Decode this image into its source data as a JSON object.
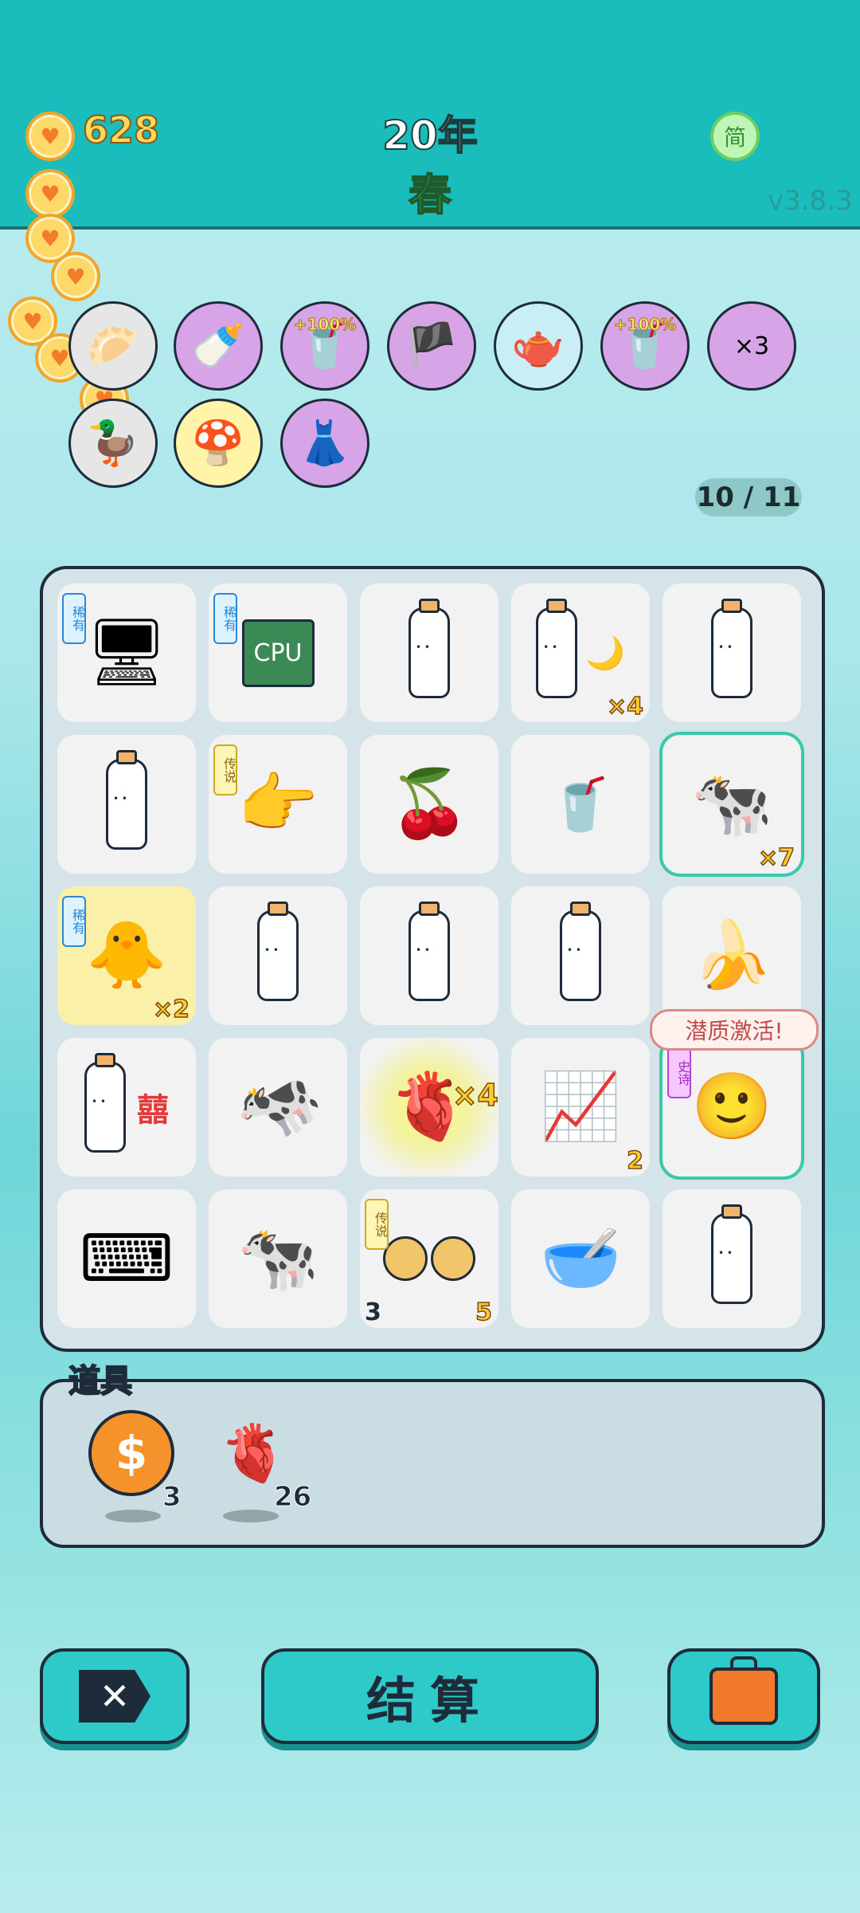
{
  "header": {
    "coins": "628",
    "year": "20年",
    "season": "春",
    "language_button": "简",
    "version": "v3.8.3"
  },
  "relics": [
    {
      "name": "steamed-bun-icon",
      "color": "gray",
      "pct": ""
    },
    {
      "name": "breast-pump-icon",
      "color": "purple",
      "pct": ""
    },
    {
      "name": "milk-tea-cup-icon",
      "color": "purple",
      "pct": "+100%"
    },
    {
      "name": "eyepatch-longan-icon",
      "color": "purple",
      "pct": ""
    },
    {
      "name": "milk-jug-icon",
      "color": "blue",
      "pct": ""
    },
    {
      "name": "milk-tea-cup-icon",
      "color": "purple",
      "pct": "+100%"
    },
    {
      "name": "multiplier-math-icon",
      "color": "purple",
      "pct": ""
    },
    {
      "name": "duck-bathtub-icon",
      "color": "gray",
      "pct": ""
    },
    {
      "name": "mushroom-cloud-icon",
      "color": "yellow",
      "pct": ""
    },
    {
      "name": "pleated-skirt-icon",
      "color": "purple",
      "pct": ""
    }
  ],
  "page_indicator": "10 / 11",
  "board": {
    "tags": {
      "rare": "稀有",
      "legend": "传说",
      "epic": "史诗"
    },
    "cells": [
      {
        "item": "computer-tower-icon",
        "glyph": "🖥",
        "tag": "rare"
      },
      {
        "item": "cpu-chip-icon",
        "glyph": "CPU",
        "tag": "rare"
      },
      {
        "item": "milk-bottle-icon",
        "glyph": "bottle"
      },
      {
        "item": "milk-bottle-moon-icon",
        "glyph": "bottle",
        "mult": "×4"
      },
      {
        "item": "milk-bottle-icon",
        "glyph": "bottle"
      },
      {
        "item": "milk-bottle-icon",
        "glyph": "bottle"
      },
      {
        "item": "pointing-finger-icon",
        "glyph": "👉",
        "tag": "legend"
      },
      {
        "item": "cherries-icon",
        "glyph": "🍒"
      },
      {
        "item": "boba-cup-icon",
        "glyph": "🥤"
      },
      {
        "item": "cow-icon",
        "glyph": "🐄",
        "mult": "×7",
        "highlight": true
      },
      {
        "item": "chick-icon",
        "glyph": "🐥",
        "tag": "rare",
        "mult": "×2",
        "gold": true
      },
      {
        "item": "milk-bottle-icon",
        "glyph": "bottle"
      },
      {
        "item": "milk-bottle-icon",
        "glyph": "bottle"
      },
      {
        "item": "milk-bottle-icon",
        "glyph": "bottle"
      },
      {
        "item": "banana-icon",
        "glyph": "🍌"
      },
      {
        "item": "milk-bottle-double-happiness-icon",
        "glyph": "bottle"
      },
      {
        "item": "tilted-cow-icon",
        "glyph": "🐄"
      },
      {
        "item": "liver-burst-icon",
        "glyph": "🫀",
        "mult": "×4"
      },
      {
        "item": "growth-chart-icon",
        "glyph": "📈",
        "count_r": "2"
      },
      {
        "item": "face-portrait-icon",
        "glyph": "🙂",
        "tag": "epic",
        "highlight": true
      },
      {
        "item": "keyboard-icon",
        "glyph": "⌨"
      },
      {
        "item": "cow-icon",
        "glyph": "🐄"
      },
      {
        "item": "longan-icon",
        "glyph": "🟤",
        "tag": "legend",
        "count_l": "3",
        "mult": "5"
      },
      {
        "item": "bowl-icon",
        "glyph": "🥣"
      },
      {
        "item": "milk-bottle-icon",
        "glyph": "bottle"
      }
    ],
    "tooltip": "潜质激活!"
  },
  "tools": {
    "label": "道具",
    "items": [
      {
        "name": "coin-token-icon",
        "glyph": "$",
        "count": "3"
      },
      {
        "name": "liver-icon",
        "glyph": "🫀",
        "count": "26"
      }
    ]
  },
  "buttons": {
    "settle_label": "结算"
  },
  "colors": {
    "header_bg": "#1bbcbc",
    "button_bg": "#2ec9c9",
    "coin_text": "#ffd85d",
    "season_text": "#39d96b"
  }
}
